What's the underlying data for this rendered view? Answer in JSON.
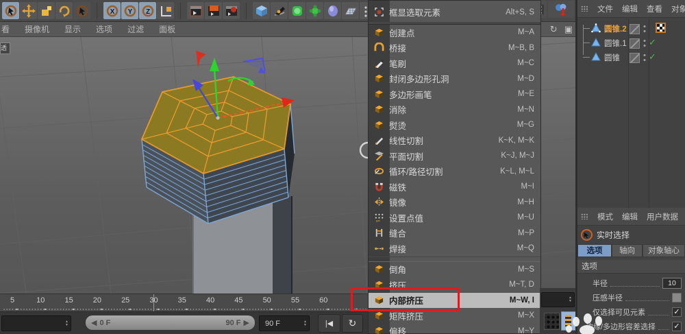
{
  "colors": {
    "accent_orange": "#e8a132",
    "annotation_red": "#d81f1f",
    "tab_active_blue": "#7d9cc8",
    "check_green": "#49b849",
    "wire_blue": "#7fa6d4",
    "selected_face_yellow": "#8e7b20",
    "selected_name_orange": "#e8a33d"
  },
  "toolbar": {
    "groups": [
      [
        "select-cursor",
        "move",
        "scale",
        "rotate",
        "snap-cursor"
      ],
      [
        "axis-x",
        "axis-y",
        "axis-z",
        "coordinate-system"
      ],
      [
        "render-view",
        "render-region",
        "render-settings"
      ],
      [
        "primitive-cube",
        "spline-pen",
        "subdivision-surface",
        "deformer",
        "field",
        "floor",
        "mini-dots"
      ]
    ],
    "axis_labels": {
      "axis-x": "X",
      "axis-y": "Y",
      "axis-z": "Z"
    },
    "right_icons": [
      "xyz-band",
      "coordinates-manager"
    ]
  },
  "viewport": {
    "menu_items": [
      "看",
      "摄像机",
      "显示",
      "选项",
      "过滤",
      "面板"
    ],
    "nav_icons": [
      "pan-view",
      "rotate-view",
      "toggle-panel"
    ],
    "nav_glyphs": [
      "⇕",
      "↻",
      "▣"
    ],
    "view_label": "透"
  },
  "context_menu": {
    "header": {
      "label": "框显选取元素",
      "shortcut": "Alt+S, S",
      "icon": "frame-selected"
    },
    "items": [
      {
        "label": "创建点",
        "shortcut": "M~A",
        "icon": "create-point"
      },
      {
        "label": "桥接",
        "shortcut": "M~B, B",
        "icon": "bridge"
      },
      {
        "label": "笔刷",
        "shortcut": "M~C",
        "icon": "brush"
      },
      {
        "label": "封闭多边形孔洞",
        "shortcut": "M~D",
        "icon": "close-polygon-hole"
      },
      {
        "label": "多边形画笔",
        "shortcut": "M~E",
        "icon": "polygon-pen"
      },
      {
        "label": "消除",
        "shortcut": "M~N",
        "icon": "dissolve"
      },
      {
        "label": "熨烫",
        "shortcut": "M~G",
        "icon": "iron"
      },
      {
        "label": "线性切割",
        "shortcut": "K~K, M~K",
        "icon": "line-cut"
      },
      {
        "label": "平面切割",
        "shortcut": "K~J, M~J",
        "icon": "plane-cut"
      },
      {
        "label": "循环/路径切割",
        "shortcut": "K~L, M~L",
        "icon": "loop-path-cut"
      },
      {
        "label": "磁铁",
        "shortcut": "M~I",
        "icon": "magnet"
      },
      {
        "label": "镜像",
        "shortcut": "M~H",
        "icon": "mirror"
      },
      {
        "label": "设置点值",
        "shortcut": "M~U",
        "icon": "set-point-value"
      },
      {
        "label": "缝合",
        "shortcut": "M~P",
        "icon": "stitch-and-sew"
      },
      {
        "label": "焊接",
        "shortcut": "M~Q",
        "icon": "weld"
      },
      {
        "type": "separator"
      },
      {
        "label": "倒角",
        "shortcut": "M~S",
        "icon": "bevel"
      },
      {
        "label": "挤压",
        "shortcut": "M~T, D",
        "icon": "extrude"
      },
      {
        "label": "内部挤压",
        "shortcut": "M~W, I",
        "icon": "extrude-inner",
        "highlighted": true
      },
      {
        "label": "矩阵挤压",
        "shortcut": "M~X",
        "icon": "matrix-extrude"
      },
      {
        "label": "偏移",
        "shortcut": "M~Y",
        "icon": "smooth-shift"
      }
    ]
  },
  "object_manager": {
    "menu": [
      "文件",
      "编辑",
      "查看",
      "对象"
    ],
    "objects": [
      {
        "name": "圆锥.2",
        "selected": true,
        "editable": true,
        "tag": "polygon-selection-tag",
        "enabled_check": false
      },
      {
        "name": "圆锥.1",
        "selected": false,
        "editable": false,
        "enabled_check": true
      },
      {
        "name": "圆锥",
        "selected": false,
        "editable": false,
        "enabled_check": true
      }
    ]
  },
  "attributes": {
    "menu": [
      "模式",
      "编辑",
      "用户数据"
    ],
    "tool_name": "实时选择",
    "tabs": [
      "选项",
      "轴向",
      "对象轴心"
    ],
    "active_tab": "选项",
    "section": "选项",
    "params": [
      {
        "label": "半径",
        "type": "number",
        "value": "10"
      },
      {
        "label": "压感半径",
        "type": "checkbox",
        "checked": false
      },
      {
        "label": "仅选择可见元素",
        "type": "checkbox",
        "checked": true
      },
      {
        "label": "边缘/多边形容差选择",
        "type": "checkbox",
        "checked": true
      }
    ]
  },
  "timeline": {
    "ticks": [
      5,
      10,
      15,
      20,
      25,
      30,
      35,
      40,
      45,
      50,
      55,
      60
    ],
    "range_start": "0 F",
    "range_end": "90 F",
    "current_frame": "90 F",
    "scrub_left_glyph": "◀",
    "scrub_right_glyph": "▶",
    "transport_buttons": [
      {
        "name": "go-to-start",
        "glyph": "|◀"
      },
      {
        "name": "loop-playback",
        "glyph": "↻"
      }
    ]
  }
}
